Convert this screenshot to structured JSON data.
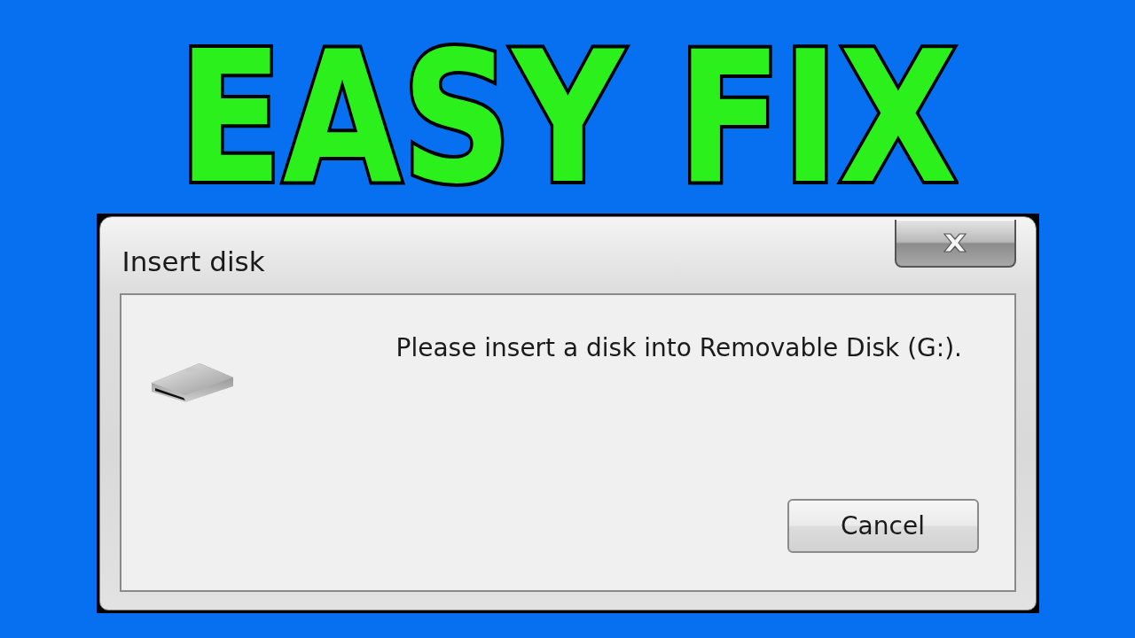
{
  "headline": "EASY FIX",
  "dialog": {
    "title": "Insert disk",
    "message": "Please insert a disk into Removable Disk (G:).",
    "buttons": [
      "Cancel"
    ]
  }
}
